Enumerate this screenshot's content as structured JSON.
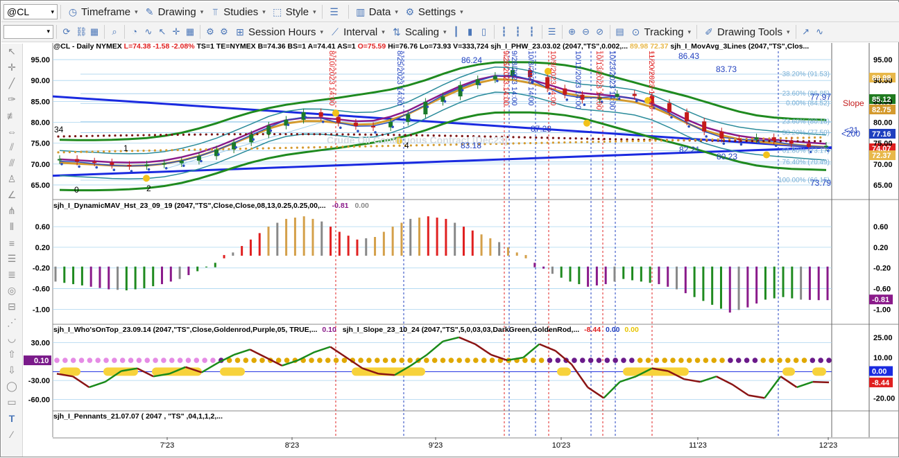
{
  "toolbar1": {
    "symbol": "@CL",
    "items": [
      {
        "label": "Timeframe",
        "icon": "clock-icon"
      },
      {
        "label": "Drawing",
        "icon": "pencil-icon"
      },
      {
        "label": "Studies",
        "icon": "studies-icon"
      },
      {
        "label": "Style",
        "icon": "style-icon"
      },
      {
        "label": "Data",
        "icon": "data-icon"
      },
      {
        "label": "Settings",
        "icon": "gear-icon"
      }
    ]
  },
  "toolbar2": {
    "items": [
      {
        "label": "Session Hours",
        "icon": "session-icon"
      },
      {
        "label": "Interval",
        "icon": "interval-icon"
      },
      {
        "label": "Scaling",
        "icon": "scaling-icon"
      },
      {
        "label": "Tracking",
        "icon": "tracking-icon"
      },
      {
        "label": "Drawing Tools",
        "icon": "drawing-tools-icon"
      }
    ]
  },
  "price_panel": {
    "header": {
      "symbol": "@CL - Daily  NYMEX",
      "last": "L=74.38",
      "chg": "-1.58",
      "chgpct": "-2.08%",
      "ts": "TS=1",
      "te": "TE=NYMEX",
      "bid": "B=74.36",
      "bs": "BS=1",
      "ask": "A=74.41",
      "as": "AS=1",
      "open": "O=75.59",
      "high": "Hi=76.76",
      "low": "Lo=73.93",
      "vol": "V=333,724",
      "study1": "sjh_I_PHW_23.03.02 (2047,\"TS\",0.002,...",
      "study1_v1": "89.98",
      "study1_v2": "72.37",
      "study2": "sjh_I_MovAvg_3Lines (2047,\"TS\",Clos..."
    },
    "watermark": "Crude Oil Continuous Contract [Dec23]",
    "axis_ticks": [
      "95.00",
      "90.00",
      "85.00",
      "80.00",
      "75.00",
      "70.00",
      "65.00"
    ],
    "price_tags": [
      {
        "value": "89.98",
        "color": "#e8b84a"
      },
      {
        "value": "85.12",
        "color": "#1f7a1f"
      },
      {
        "value": "82.75",
        "color": "#d49a2e"
      },
      {
        "value": "77.16",
        "color": "#1f3fbf"
      },
      {
        "value": "74.07",
        "color": "#e02020"
      },
      {
        "value": "72.37",
        "color": "#e8b84a"
      }
    ],
    "fib_labels": [
      "-38.20% (91.53)",
      "-23.60% (86.85)",
      "0.00% (84.52)",
      "23.60% (80.18)",
      "38.20% (77.50)",
      "61.80% (73.17)",
      "76.40% (70.49)",
      "100.00% (66.15)"
    ],
    "vertical_dates": [
      "8/10/2023 14:00",
      "8/25/2023 14:00",
      "9/26/2023 14:00",
      "9/28/2023 14:00",
      "10/3/2023 14:00",
      "10/9/2023 14:00",
      "10/11/2023 14:00",
      "10/13/2023 14:00",
      "10/23/2023 14:00",
      "11/20/2023 14:00"
    ],
    "annotations": [
      "86.24",
      "86.43",
      "83.73",
      "87.28",
      "83.18",
      "82.21",
      "80.23",
      "77.97",
      "73.79",
      "Slope",
      "<21",
      "<200",
      "34",
      "1",
      "0",
      "2",
      "4"
    ]
  },
  "hist_panel": {
    "header": "sjh_I_DynamicMAV_Hst_23_09_19 (2047,\"TS\",Close,Close,08,13,0.25,0.25,00,...",
    "v1": "-0.81",
    "v2": "0.00",
    "ticks": [
      "0.60",
      "0.20",
      "-0.20",
      "-0.60",
      "-1.00"
    ],
    "tag": "-0.81"
  },
  "osc_panel": {
    "header1": "sjh_I_Who'sOnTop_23.09.14 (2047,\"TS\",Close,Goldenrod,Purple,05,  TRUE,...",
    "h1v": "0.10",
    "header2": "sjh_I_Slope_23_10_24 (2047,\"TS\",5,0,03,03,DarkGreen,GoldenRod,...",
    "h2v1": "-8.44",
    "h2v2": "0.00",
    "h2v3": "0.00",
    "left_ticks": [
      "30.00",
      "-30.00",
      "-60.00"
    ],
    "left_tag": "0.10",
    "right_ticks": [
      "25.00",
      "10.00",
      "-20.00"
    ],
    "right_tags": [
      "0.00",
      "-8.44"
    ]
  },
  "pennant_panel": {
    "header": "sjh_I_Pennants_21.07.07 (  2047  , \"TS\" ,04,1,1,2,..."
  },
  "x_axis": [
    "7'23",
    "8'23",
    "9'23",
    "10'23",
    "11'23",
    "12'23"
  ],
  "chart_data": {
    "type": "candlestick",
    "title": "@CL - Daily NYMEX",
    "ylim": [
      62,
      97
    ],
    "x": [
      "7'23",
      "8'23",
      "9'23",
      "10'23",
      "11'23",
      "12'23"
    ],
    "close_path": [
      71.2,
      70.6,
      70.4,
      69.8,
      69.5,
      69.9,
      70.2,
      70.8,
      71.9,
      73.5,
      75.2,
      77.1,
      79.2,
      80.6,
      82.4,
      81.3,
      79.9,
      79.1,
      78.8,
      80.1,
      81.9,
      84.9,
      86.2,
      88.9,
      90.3,
      91.1,
      92.5,
      90.8,
      88.1,
      86.6,
      85.4,
      86.1,
      86.8,
      86.3,
      84.6,
      82.4,
      80.2,
      77.8,
      76.1,
      75.9,
      76.4,
      75.6,
      74.9,
      74.1,
      74.38
    ],
    "hist_values": [
      -0.45,
      -0.5,
      -0.55,
      -0.6,
      -0.62,
      -0.58,
      -0.5,
      -0.4,
      -0.25,
      -0.1,
      0.1,
      0.35,
      0.6,
      0.75,
      0.8,
      0.7,
      0.5,
      0.35,
      0.4,
      0.6,
      0.75,
      0.8,
      0.75,
      0.6,
      0.45,
      0.3,
      0.1,
      -0.1,
      -0.3,
      -0.45,
      -0.55,
      -0.5,
      -0.4,
      -0.45,
      -0.5,
      -0.6,
      -0.75,
      -0.9,
      -1.05,
      -0.95,
      -0.8,
      -0.75,
      -0.8,
      -0.81
    ],
    "slope_values": [
      -2,
      -4,
      -12,
      -8,
      0,
      2,
      -4,
      -2,
      3,
      -1,
      6,
      12,
      16,
      10,
      4,
      8,
      14,
      18,
      10,
      2,
      -2,
      -3,
      4,
      12,
      22,
      25,
      20,
      12,
      8,
      10,
      20,
      15,
      5,
      -12,
      -20,
      -8,
      -4,
      2,
      0,
      -6,
      -8,
      -4,
      -10,
      -18,
      -20,
      -4,
      -12,
      -8,
      -8.44
    ]
  }
}
